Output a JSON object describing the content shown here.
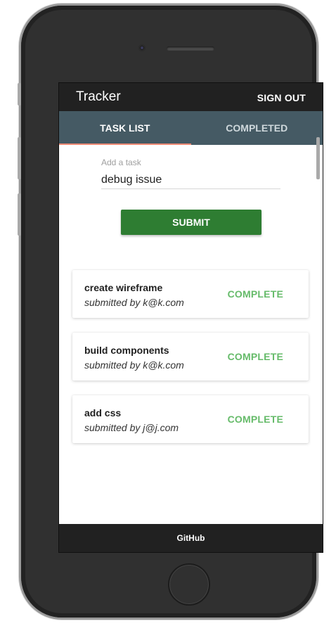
{
  "app": {
    "title": "Tracker",
    "sign_out_label": "SIGN OUT"
  },
  "tabs": [
    {
      "label": "TASK LIST",
      "active": true
    },
    {
      "label": "COMPLETED",
      "active": false
    }
  ],
  "form": {
    "input_label": "Add a task",
    "input_value": "debug issue",
    "submit_label": "SUBMIT"
  },
  "tasks": [
    {
      "name": "create wireframe",
      "submitted_by": "submitted by k@k.com",
      "action_label": "COMPLETE"
    },
    {
      "name": "build components",
      "submitted_by": "submitted by k@k.com",
      "action_label": "COMPLETE"
    },
    {
      "name": "add css",
      "submitted_by": "submitted by j@j.com",
      "action_label": "COMPLETE"
    }
  ],
  "footer": {
    "link_label": "GitHub"
  },
  "colors": {
    "app_bar": "#212121",
    "tab_bar": "#455a64",
    "tab_indicator": "#ef8a74",
    "submit_button": "#2e7d32",
    "complete_text": "#66bb6a"
  }
}
